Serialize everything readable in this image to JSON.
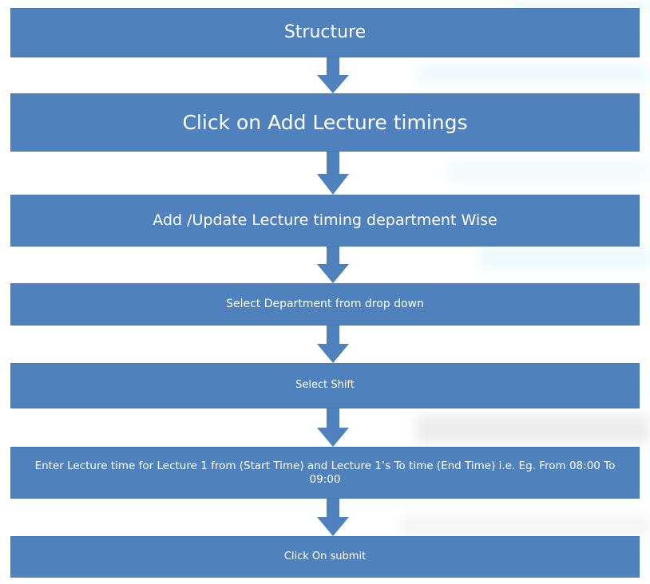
{
  "flowchart": {
    "steps": [
      {
        "label": "Structure"
      },
      {
        "label": "Click on Add Lecture timings"
      },
      {
        "label": "Add /Update Lecture timing department Wise"
      },
      {
        "label": "Select Department from drop down"
      },
      {
        "label": "Select Shift"
      },
      {
        "label": "Enter  Lecture time for Lecture 1 from (Start Time) and Lecture 1’s To time (End Time) i.e. Eg. From 08:00 To 09:00"
      },
      {
        "label": "Click On submit"
      }
    ],
    "colors": {
      "box_fill": "#4f81bd",
      "box_text": "#ffffff",
      "arrow_fill": "#4f81bd"
    }
  }
}
